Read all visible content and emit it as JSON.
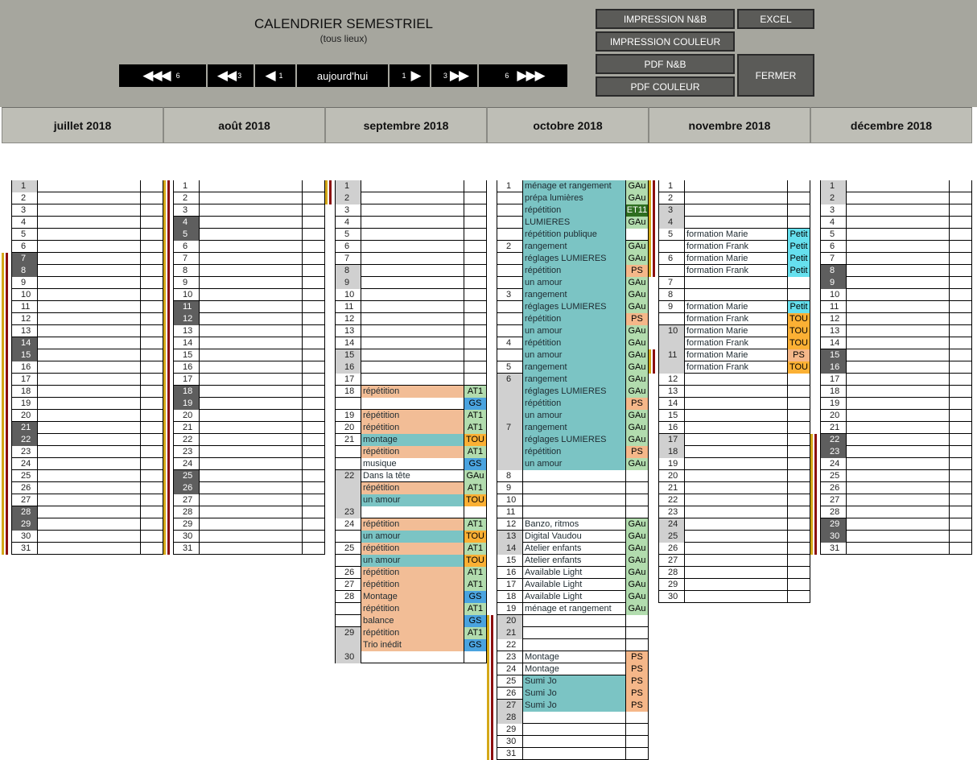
{
  "header": {
    "title": "CALENDRIER SEMESTRIEL",
    "subtitle": "(tous lieux)",
    "nav": [
      {
        "id": "back6",
        "arrows": "◀◀◀",
        "num": "6"
      },
      {
        "id": "back3",
        "arrows": "◀◀",
        "num": "3"
      },
      {
        "id": "back1",
        "arrows": "◀",
        "num": "1"
      },
      {
        "id": "today",
        "label": "aujourd'hui"
      },
      {
        "id": "fwd1",
        "arrows": "▶",
        "num": "1"
      },
      {
        "id": "fwd3",
        "arrows": "▶▶",
        "num": "3"
      },
      {
        "id": "fwd6",
        "arrows": "▶▶▶",
        "num": "6"
      }
    ],
    "buttons": {
      "print_bw": "IMPRESSION N&B",
      "excel": "EXCEL",
      "print_color": "IMPRESSION COULEUR",
      "pdf_bw": "PDF  N&B",
      "pdf_color": "PDF COULEUR",
      "close": "FERMER"
    }
  },
  "colors": {
    "teal": "#7bc4c4",
    "salmon": "#f2bd96",
    "tag_green": "#b2dcae",
    "tag_orange": "#fbb034",
    "tag_blue": "#4aa3df",
    "tag_cyan": "#66e0ee",
    "tag_dark_green": "#2e6e20",
    "tag_salmon": "#f5b789",
    "weekend_dark": "#5e5e5e",
    "weekend_light": "#d0d0d0",
    "stripe_colors": [
      "#d4a818",
      "#8b0e0e"
    ]
  },
  "months": [
    {
      "name": "juillet 2018",
      "days": 31,
      "first": "sun",
      "events": {}
    },
    {
      "name": "août 2018",
      "days": 31,
      "first": "wed",
      "events": {}
    },
    {
      "name": "septembre 2018",
      "days": 30,
      "first": "sat",
      "events": {
        "18": [
          {
            "t": "répétition",
            "tag": "AT1"
          },
          {
            "t": "",
            "tag": "GS"
          }
        ],
        "19": [
          {
            "t": "répétition",
            "tag": "AT1"
          }
        ],
        "20": [
          {
            "t": "répétition",
            "tag": "AT1"
          }
        ],
        "21": [
          {
            "t": "montage",
            "tag": "TOU"
          },
          {
            "t": "répétition",
            "tag": "AT1"
          },
          {
            "t": "musique",
            "tag": "GS"
          }
        ],
        "22": [
          {
            "t": "Dans la tête",
            "tag": "GAu"
          },
          {
            "t": "répétition",
            "tag": "AT1"
          },
          {
            "t": "un amour",
            "tag": "TOU"
          }
        ],
        "24": [
          {
            "t": "répétition",
            "tag": "AT1"
          },
          {
            "t": "un amour",
            "tag": "TOU"
          }
        ],
        "25": [
          {
            "t": "répétition",
            "tag": "AT1"
          },
          {
            "t": "un amour",
            "tag": "TOU"
          }
        ],
        "26": [
          {
            "t": "répétition",
            "tag": "AT1"
          }
        ],
        "27": [
          {
            "t": "répétition",
            "tag": "AT1"
          }
        ],
        "28": [
          {
            "t": "Montage",
            "tag": "GS"
          },
          {
            "t": "répétition",
            "tag": "AT1"
          },
          {
            "t": "balance",
            "tag": "GS"
          }
        ],
        "29": [
          {
            "t": "répétition",
            "tag": "AT1"
          },
          {
            "t": "Trio inédit",
            "tag": "GS"
          }
        ]
      }
    },
    {
      "name": "octobre 2018",
      "days": 31,
      "first": "mon",
      "events": {
        "1": [
          {
            "t": "ménage et rangement",
            "tag": "GAu"
          },
          {
            "t": "prépa lumières",
            "tag": "GAu"
          },
          {
            "t": "répétition",
            "tag": "ET11"
          },
          {
            "t": "LUMIERES",
            "tag": "GAu"
          },
          {
            "t": "répétition publique",
            "tag": ""
          }
        ],
        "2": [
          {
            "t": "rangement",
            "tag": "GAu"
          },
          {
            "t": "réglages LUMIERES",
            "tag": "GAu"
          },
          {
            "t": "répétition",
            "tag": "PS"
          },
          {
            "t": "un amour",
            "tag": "GAu"
          }
        ],
        "3": [
          {
            "t": "rangement",
            "tag": "GAu"
          },
          {
            "t": "réglages LUMIERES",
            "tag": "GAu"
          },
          {
            "t": "répétition",
            "tag": "PS"
          },
          {
            "t": "un amour",
            "tag": "GAu"
          }
        ],
        "4": [
          {
            "t": "répétition",
            "tag": "GAu"
          },
          {
            "t": "un amour",
            "tag": "GAu"
          }
        ],
        "5": [
          {
            "t": "rangement",
            "tag": "GAu"
          }
        ],
        "6": [
          {
            "t": "rangement",
            "tag": "GAu"
          },
          {
            "t": "réglages LUMIERES",
            "tag": "GAu"
          },
          {
            "t": "répétition",
            "tag": "PS"
          },
          {
            "t": "un amour",
            "tag": "GAu"
          }
        ],
        "7": [
          {
            "t": "rangement",
            "tag": "GAu"
          },
          {
            "t": "réglages LUMIERES",
            "tag": "GAu"
          },
          {
            "t": "répétition",
            "tag": "PS"
          },
          {
            "t": "un amour",
            "tag": "GAu"
          }
        ],
        "12": [
          {
            "t": "Banzo, ritmos",
            "tag": "GAu"
          }
        ],
        "13": [
          {
            "t": "Digital Vaudou",
            "tag": "GAu"
          }
        ],
        "14": [
          {
            "t": "Atelier enfants",
            "tag": "GAu"
          }
        ],
        "15": [
          {
            "t": "Atelier enfants",
            "tag": "GAu"
          }
        ],
        "16": [
          {
            "t": "Available Light",
            "tag": "GAu"
          }
        ],
        "17": [
          {
            "t": "Available Light",
            "tag": "GAu"
          }
        ],
        "18": [
          {
            "t": "Available Light",
            "tag": "GAu"
          }
        ],
        "19": [
          {
            "t": "ménage et rangement",
            "tag": "GAu"
          }
        ],
        "23": [
          {
            "t": "Montage",
            "tag": "PS"
          }
        ],
        "24": [
          {
            "t": "Montage",
            "tag": "PS"
          }
        ],
        "25": [
          {
            "t": "Sumi Jo",
            "tag": "PS"
          }
        ],
        "26": [
          {
            "t": "Sumi Jo",
            "tag": "PS"
          }
        ],
        "27": [
          {
            "t": "Sumi Jo",
            "tag": "PS"
          }
        ]
      }
    },
    {
      "name": "novembre 2018",
      "days": 30,
      "first": "thu",
      "events": {
        "5": [
          {
            "t": "formation Marie",
            "tag": "Petit"
          },
          {
            "t": "formation Frank",
            "tag": "Petit"
          }
        ],
        "6": [
          {
            "t": "formation Marie",
            "tag": "Petit"
          },
          {
            "t": "formation Frank",
            "tag": "Petit"
          }
        ],
        "9": [
          {
            "t": "formation Marie",
            "tag": "Petit"
          },
          {
            "t": "formation Frank",
            "tag": "TOU"
          }
        ],
        "10": [
          {
            "t": "formation Marie",
            "tag": "TOU"
          },
          {
            "t": "formation Frank",
            "tag": "TOU"
          }
        ],
        "11": [
          {
            "t": "formation Marie",
            "tag": "PS"
          },
          {
            "t": "formation Frank",
            "tag": "TOU"
          }
        ]
      }
    },
    {
      "name": "décembre 2018",
      "days": 31,
      "first": "sat",
      "events": {}
    }
  ]
}
